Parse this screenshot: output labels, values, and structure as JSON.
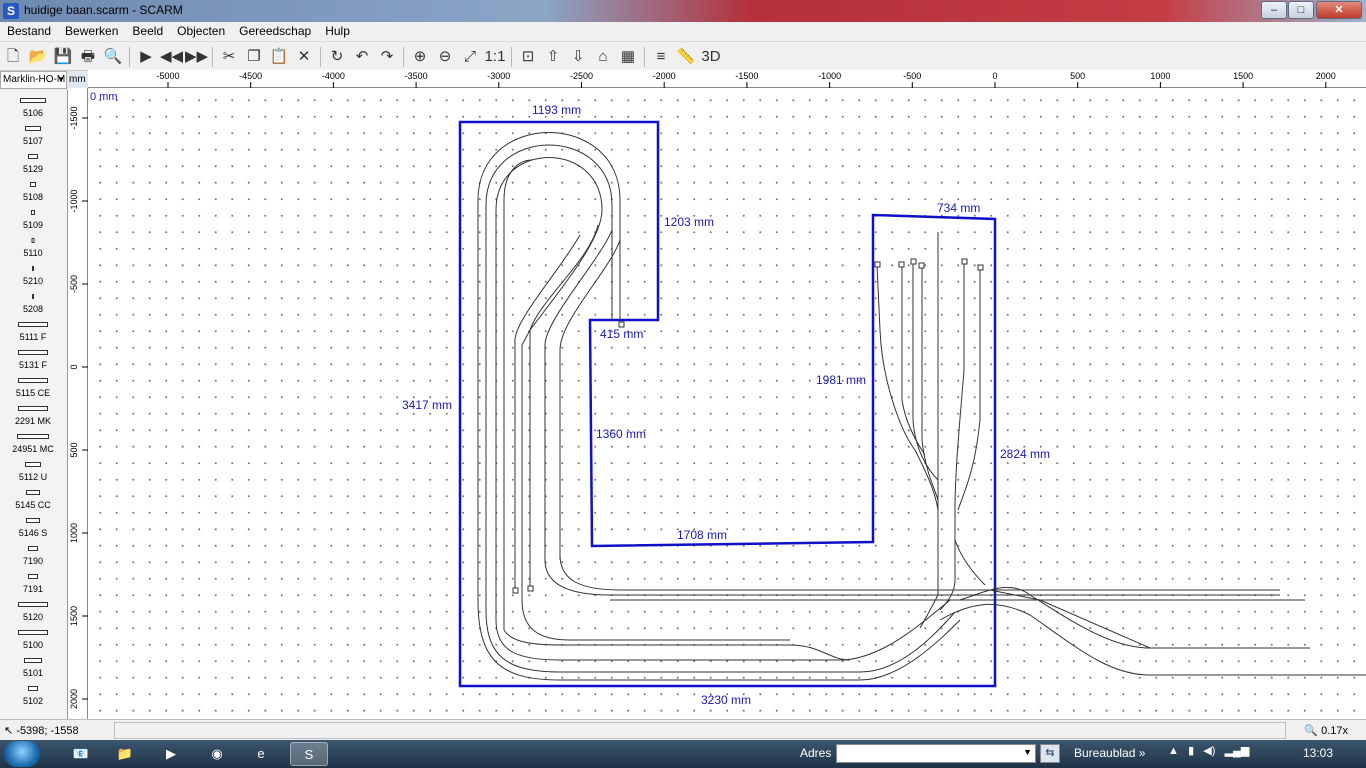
{
  "window": {
    "title": "huidige baan.scarm - SCARM",
    "app_icon_letter": "S",
    "minimize": "–",
    "maximize": "□",
    "close": "✕"
  },
  "menu": [
    "Bestand",
    "Bewerken",
    "Beeld",
    "Objecten",
    "Gereedschap",
    "Hulp"
  ],
  "toolbar": {
    "icons": [
      "new-file-icon",
      "open-folder-icon",
      "save-icon",
      "print-icon",
      "print-preview-icon",
      "play-icon",
      "step-back-icon",
      "step-forward-icon",
      "cut-icon",
      "copy-icon",
      "paste-icon",
      "delete-icon",
      "rotate-icon",
      "undo-icon",
      "redo-icon",
      "zoom-in-icon",
      "zoom-out-icon",
      "fit-view-icon",
      "zoom-1to1-icon",
      "snap-icon",
      "flex-track-icon",
      "join-icon",
      "bridge-icon",
      "elevation-icon",
      "layers-icon",
      "tape-measure-icon",
      "3d-view-icon"
    ],
    "glyphs": [
      "🗋",
      "📂",
      "💾",
      "🖶",
      "🔍",
      "▶",
      "◀◀",
      "▶▶",
      "✂",
      "❐",
      "📋",
      "✕",
      "↻",
      "↶",
      "↷",
      "⊕",
      "⊖",
      "⤢",
      "1:1",
      "⊡",
      "⇧",
      "⇩",
      "⌂",
      "▦",
      "≡",
      "📏",
      "3D"
    ]
  },
  "library": {
    "selected": "Marklin-HO-M",
    "unit_label": "mm",
    "items": [
      {
        "label": "5106",
        "w": 26
      },
      {
        "label": "5107",
        "w": 16
      },
      {
        "label": "5129",
        "w": 10
      },
      {
        "label": "5108",
        "w": 6
      },
      {
        "label": "5109",
        "w": 4
      },
      {
        "label": "5110",
        "w": 3
      },
      {
        "label": "5210",
        "w": 2
      },
      {
        "label": "5208",
        "w": 2
      },
      {
        "label": "5111 F",
        "w": 30
      },
      {
        "label": "5131 F",
        "w": 30
      },
      {
        "label": "5115 CE",
        "w": 30
      },
      {
        "label": "2291 MK",
        "w": 30
      },
      {
        "label": "24951 MC",
        "w": 32
      },
      {
        "label": "5112 U",
        "w": 16
      },
      {
        "label": "5145 CC",
        "w": 14
      },
      {
        "label": "5146 S",
        "w": 14
      },
      {
        "label": "7190",
        "w": 10
      },
      {
        "label": "7191",
        "w": 10
      },
      {
        "label": "5120",
        "w": 30
      },
      {
        "label": "5100",
        "w": 30
      },
      {
        "label": "5101",
        "w": 18
      },
      {
        "label": "5102",
        "w": 10
      }
    ]
  },
  "rulers": {
    "h_ticks": [
      "-5000",
      "-4500",
      "-4000",
      "-3500",
      "-3000",
      "-2500",
      "-2000",
      "-1500",
      "-1000",
      "-500",
      "0",
      "500",
      "1000",
      "1500",
      "2000"
    ],
    "v_ticks": [
      "-1500",
      "-1000",
      "-500",
      "0",
      "500",
      "1000",
      "1500",
      "2000"
    ],
    "origin_label": "0 mm"
  },
  "dimensions": {
    "top": "1193 mm",
    "right_upper": "1203 mm",
    "inner_top": "415 mm",
    "inner_left": "1360 mm",
    "inner_bottom": "1708 mm",
    "inner_right": "1981 mm",
    "right_top": "734 mm",
    "right_side": "2824 mm",
    "left_side": "3417 mm",
    "bottom": "3230 mm"
  },
  "colors": {
    "outline": "#1010c8",
    "dim_text": "#1a1ab0",
    "track": "#333333"
  },
  "status": {
    "coords": "-5398; -1558",
    "zoom": "0.17x"
  },
  "taskbar": {
    "address_label": "Adres",
    "address_value": "",
    "desktop_label": "Bureaublad",
    "chevron": "»",
    "clock": "13:03"
  }
}
